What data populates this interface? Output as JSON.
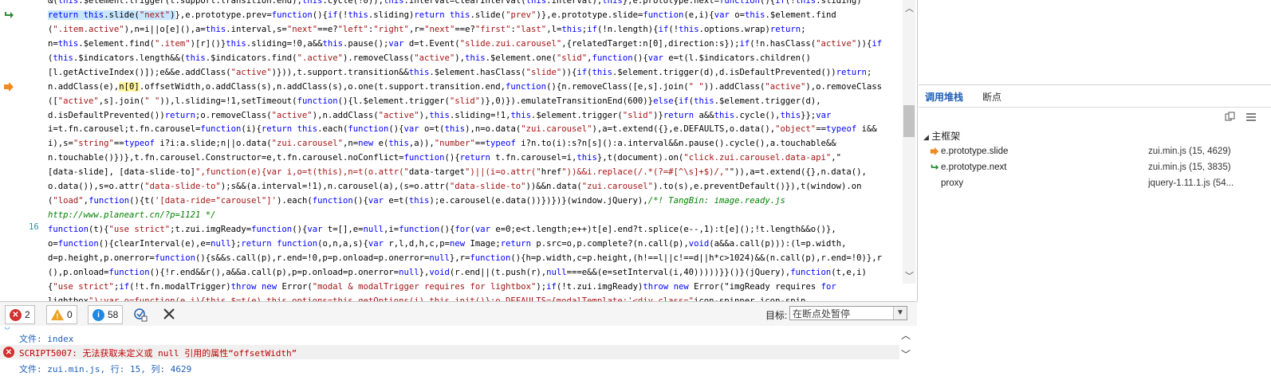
{
  "code": {
    "lines": [
      "&(this.$element.trigger(t.support.transition.end),this.cycle(!0)),this.interval=clearInterval(this.interval),this},e.prototype.next=function(){if(!this.sliding)",
      "return this.slide(\"next\")},e.prototype.prev=function(){if(!this.sliding)return this.slide(\"prev\")},e.prototype.slide=function(e,i){var o=this.$element.find",
      "(\".item.active\"),n=i||o[e](),a=this.interval,s=\"next\"==e?\"left\":\"right\",r=\"next\"==e?\"first\":\"last\",l=this;if(!n.length){if(!this.options.wrap)return;",
      "n=this.$element.find(\".item\")[r]()}this.sliding=!0,a&&this.pause();var d=t.Event(\"slide.zui.carousel\",{relatedTarget:n[0],direction:s});if(!n.hasClass(\"active\")){if",
      "(this.$indicators.length&&(this.$indicators.find(\".active\").removeClass(\"active\"),this.$element.one(\"slid\",function(){var e=t(l.$indicators.children()",
      "[l.getActiveIndex()]);e&&e.addClass(\"active\")})),t.support.transition&&this.$element.hasClass(\"slide\")){if(this.$element.trigger(d),d.isDefaultPrevented())return;",
      "n.addClass(e),n[0].offsetWidth,o.addClass(s),n.addClass(s),o.one(t.support.transition.end,function(){n.removeClass([e,s].join(\" \")).addClass(\"active\"),o.removeClass",
      "([\"active\",s].join(\" \")),l.sliding=!1,setTimeout(function(){l.$element.trigger(\"slid\")},0)}).emulateTransitionEnd(600)}else{if(this.$element.trigger(d),",
      "d.isDefaultPrevented())return;o.removeClass(\"active\"),n.addClass(\"active\"),this.sliding=!1,this.$element.trigger(\"slid\")}return a&&this.cycle(),this}};var",
      "i=t.fn.carousel;t.fn.carousel=function(i){return this.each(function(){var o=t(this),n=o.data(\"zui.carousel\"),a=t.extend({},e.DEFAULTS,o.data(),\"object\"==typeof i&&",
      "i),s=\"string\"==typeof i?i:a.slide;n||o.data(\"zui.carousel\",n=new e(this,a)),\"number\"==typeof i?n.to(i):s?n[s]():a.interval&&n.pause().cycle(),a.touchable&&",
      "n.touchable()})},t.fn.carousel.Constructor=e,t.fn.carousel.noConflict=function(){return t.fn.carousel=i,this},t(document).on(\"click.zui.carousel.data-api\",\"",
      "[data-slide], [data-slide-to]\",function(e){var i,o=t(this),n=t(o.attr(\"data-target\")||(i=o.attr(\"href\"))&&i.replace(/.*(?=#[^\\s]+$)/,\"\")),a=t.extend({},n.data(),",
      "o.data()),s=o.attr(\"data-slide-to\");s&&(a.interval=!1),n.carousel(a),(s=o.attr(\"data-slide-to\"))&&n.data(\"zui.carousel\").to(s),e.preventDefault()}),t(window).on",
      "(\"load\",function(){t('[data-ride=\"carousel\"]').each(function(){var e=t(this);e.carousel(e.data())})})}(window.jQuery),/*! TangBin: image.ready.js",
      "http://www.planeart.cn/?p=1121 */",
      "function(t){\"use strict\";t.zui.imgReady=function(){var t=[],e=null,i=function(){for(var e=0;e<t.length;e++)t[e].end?t.splice(e--,1):t[e]();!t.length&&o()},",
      "o=function(){clearInterval(e),e=null};return function(o,n,a,s){var r,l,d,h,c,p=new Image;return p.src=o,p.complete?(n.call(p),void(a&&a.call(p))):(l=p.width,",
      "d=p.height,p.onerror=function(){s&&s.call(p),r.end=!0,p=p.onload=p.onerror=null},r=function(){h=p.width,c=p.height,(h!==l||c!==d||h*c>1024)&&(n.call(p),r.end=!0)},r",
      "(),p.onload=function(){!r.end&&r(),a&&a.call(p),p=p.onload=p.onerror=null},void(r.end||(t.push(r),null===e&&(e=setInterval(i,40)))))}}()}(jQuery),function(t,e,i)",
      "{\"use strict\";if(!t.fn.modalTrigger)throw new Error(\"modal & modalTrigger requires for lightbox\");if(!t.zui.imgReady)throw new Error(\"imgReady requires for",
      "lightbox\");var o=function(e,i){this.$=t(e),this.options=this.getOptions(i),this.init()};o.DEFAULTS={modalTemplate:'<div class=\"icon-spinner icon-spin"
    ],
    "line_number": "16",
    "highlight_text": "return this.slide(\"next\")",
    "current_token": "n[0]"
  },
  "callstack": {
    "tabs": [
      "调用堆栈",
      "断点"
    ],
    "root": "主框架",
    "frames": [
      {
        "name": "e.prototype.slide",
        "location": "zui.min.js (15, 4629)",
        "icon": "current-statement-arrow-icon"
      },
      {
        "name": "e.prototype.next",
        "location": "zui.min.js (15, 3835)",
        "icon": "return-arrow-icon"
      },
      {
        "name": "proxy",
        "location": "jquery-1.11.1.js (54...",
        "icon": ""
      }
    ]
  },
  "console": {
    "errors": "2",
    "warnings": "0",
    "messages": "58",
    "target_label": "目标:",
    "target_value": "在断点处暂停",
    "lines": {
      "file_index": "文件: index",
      "error": "SCRIPT5007: 无法获取未定义或 null 引用的属性“offsetWidth”",
      "error_location": "文件: zui.min.js, 行: 15, 列: 4629"
    }
  },
  "colors": {
    "accent": "#1e5fb4",
    "error": "#d32f2f",
    "warning": "#f0a020",
    "info": "#1e88e5",
    "arrow_orange": "#f08a20",
    "arrow_green": "#2e8b3a"
  }
}
